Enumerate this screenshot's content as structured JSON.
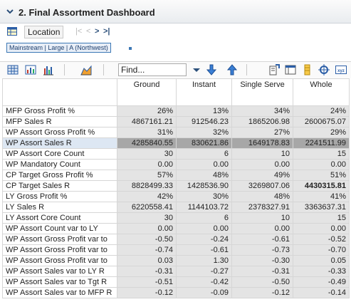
{
  "header": {
    "title": "2. Final Assortment Dashboard"
  },
  "location": {
    "button_label": "Location",
    "selected": "Mainstream | Large | A (Northwest)"
  },
  "nav_icons": [
    "first-page-icon",
    "previous-icon",
    "next-icon",
    "last-page-icon"
  ],
  "find": {
    "placeholder": "Find..."
  },
  "columns": [
    "Ground",
    "Instant",
    "Single Serve",
    "Whole"
  ],
  "rows": [
    {
      "label": "MFP Gross Profit %",
      "values": [
        "26%",
        "13%",
        "34%",
        "24%"
      ]
    },
    {
      "label": "MFP Sales R",
      "values": [
        "4867161.21",
        "912546.23",
        "1865206.98",
        "2600675.07"
      ]
    },
    {
      "label": "WP Assort Gross Profit %",
      "values": [
        "31%",
        "32%",
        "27%",
        "29%"
      ]
    },
    {
      "label": "WP Assort Sales R",
      "values": [
        "4285840.55",
        "830621.86",
        "1649178.83",
        "2241511.99"
      ],
      "selected": true
    },
    {
      "label": "WP Assort Core Count",
      "values": [
        "30",
        "6",
        "10",
        "15"
      ]
    },
    {
      "label": "WP Mandatory Count",
      "values": [
        "0.00",
        "0.00",
        "0.00",
        "0.00"
      ]
    },
    {
      "label": "CP Target Gross Profit %",
      "values": [
        "57%",
        "48%",
        "49%",
        "51%"
      ]
    },
    {
      "label": "CP Target Sales R",
      "values": [
        "8828499.33",
        "1428536.90",
        "3269807.06",
        "4430315.81"
      ],
      "bold_last": true
    },
    {
      "label": "LY Gross Profit %",
      "values": [
        "42%",
        "30%",
        "48%",
        "41%"
      ]
    },
    {
      "label": "LY Sales R",
      "values": [
        "6220558.41",
        "1144103.72",
        "2378327.91",
        "3363637.31"
      ]
    },
    {
      "label": "LY Assort Core Count",
      "values": [
        "30",
        "6",
        "10",
        "15"
      ]
    },
    {
      "label": "WP Assort Count var to LY",
      "values": [
        "0.00",
        "0.00",
        "0.00",
        "0.00"
      ]
    },
    {
      "label": "WP Assort Gross Profit var to",
      "values": [
        "-0.50",
        "-0.24",
        "-0.61",
        "-0.52"
      ]
    },
    {
      "label": "WP Assort Gross Profit var to",
      "values": [
        "-0.74",
        "-0.61",
        "-0.73",
        "-0.70"
      ]
    },
    {
      "label": "WP Assort Gross Profit var to",
      "values": [
        "0.03",
        "1.30",
        "-0.30",
        "0.05"
      ]
    },
    {
      "label": "WP Assort Sales var to LY R",
      "values": [
        "-0.31",
        "-0.27",
        "-0.31",
        "-0.33"
      ]
    },
    {
      "label": "WP Assort Sales var to Tgt R",
      "values": [
        "-0.51",
        "-0.42",
        "-0.50",
        "-0.49"
      ]
    },
    {
      "label": "WP Assort Sales var to MFP R",
      "values": [
        "-0.12",
        "-0.09",
        "-0.12",
        "-0.14"
      ]
    }
  ],
  "colors": {
    "header_bg": "#eceff2",
    "cell_bg": "#e4e4e4",
    "selected_cell_bg": "#a7a7a7",
    "accent": "#3c78b5"
  }
}
